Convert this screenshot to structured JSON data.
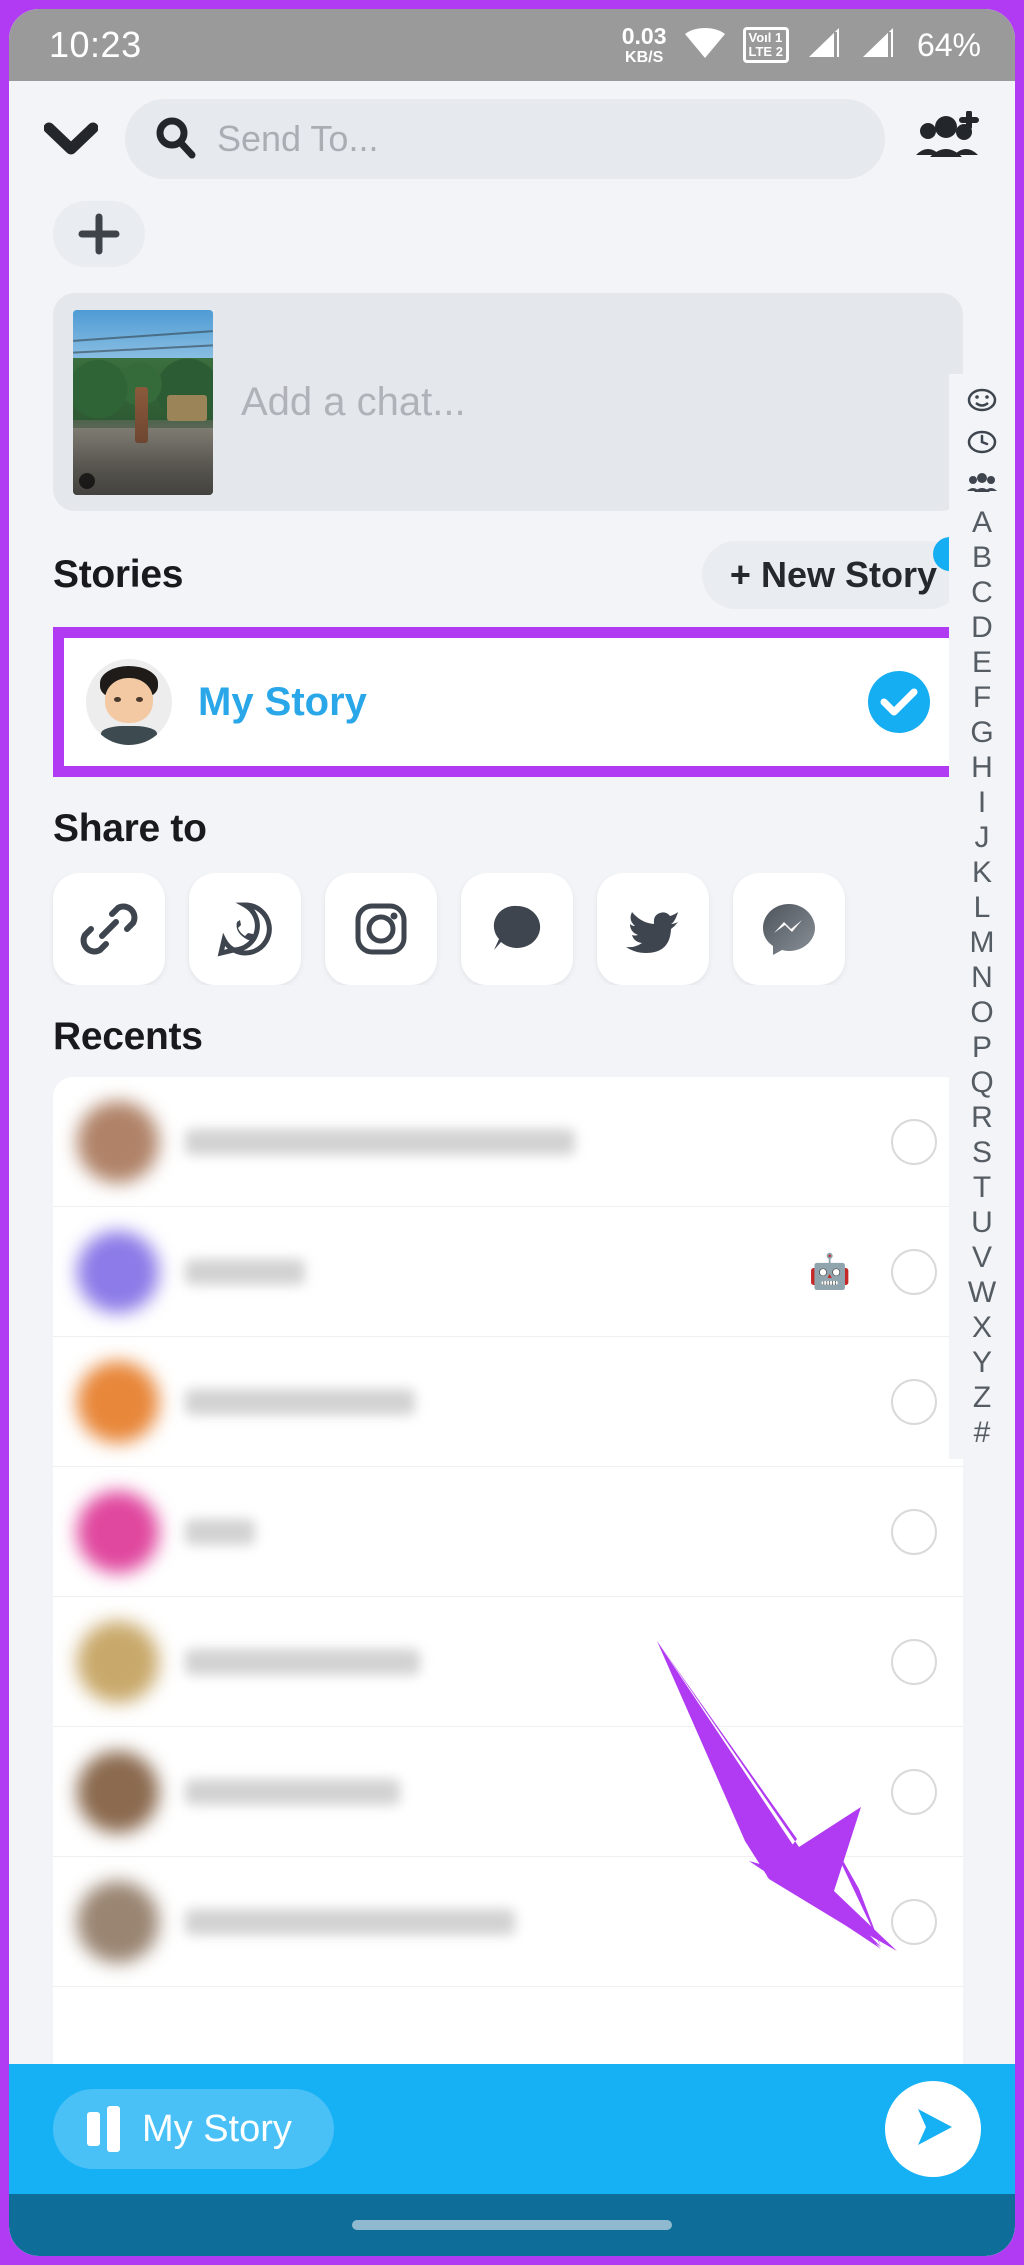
{
  "theme": {
    "accent_purple": "#B13BF2",
    "snap_blue": "#16B0F5",
    "story_link_blue": "#2AA7E8",
    "page_bg": "#F2F4F7",
    "navbar": "#0E6E99"
  },
  "statusbar": {
    "time": "10:23",
    "net_speed_value": "0.03",
    "net_speed_unit": "KB/S",
    "wifi_icon": "wifi-icon",
    "volte_line1": "Voıl 1",
    "volte_line2": "LTE 2",
    "signal1_icon": "signal-bars-icon",
    "signal2_icon": "signal-bars-icon",
    "battery": "64%"
  },
  "header": {
    "collapse_icon": "chevron-down-icon",
    "search_placeholder": "Send To...",
    "search_value": "",
    "search_icon": "search-icon",
    "add_group_icon": "add-group-icon",
    "add_button_label": "+"
  },
  "chat_composer": {
    "thumbnail_alt": "snap-preview-thumbnail",
    "placeholder": "Add a chat..."
  },
  "stories": {
    "title": "Stories",
    "new_story_label": "+ New Story",
    "new_story_has_badge": true,
    "my_story": {
      "label": "My Story",
      "avatar": "bitmoji-avatar",
      "selected": true,
      "check_icon": "check-circle-icon"
    }
  },
  "share_to": {
    "title": "Share to",
    "items": [
      {
        "name": "copy-link-icon",
        "label": "Copy Link"
      },
      {
        "name": "whatsapp-icon",
        "label": "WhatsApp"
      },
      {
        "name": "instagram-icon",
        "label": "Instagram"
      },
      {
        "name": "message-bubble-icon",
        "label": "Messages"
      },
      {
        "name": "twitter-icon",
        "label": "Twitter"
      },
      {
        "name": "messenger-icon",
        "label": "Messenger"
      }
    ]
  },
  "recents": {
    "title": "Recents",
    "rows": [
      {
        "avatar_color": "#B08368",
        "name_width": 390,
        "sub_width": 0,
        "emoji": "",
        "selected": false
      },
      {
        "avatar_color": "#8C7BE8",
        "name_width": 120,
        "sub_width": 0,
        "emoji": "🤖",
        "selected": false
      },
      {
        "avatar_color": "#E8873A",
        "name_width": 230,
        "sub_width": 0,
        "emoji": "",
        "selected": false
      },
      {
        "avatar_color": "#E0479E",
        "name_width": 70,
        "sub_width": 0,
        "emoji": "",
        "selected": false
      },
      {
        "avatar_color": "#C9A96B",
        "name_width": 235,
        "sub_width": 0,
        "emoji": "",
        "selected": false
      },
      {
        "avatar_color": "#8B6A4F",
        "name_width": 215,
        "sub_width": 0,
        "emoji": "",
        "selected": false
      },
      {
        "avatar_color": "#9A8572",
        "name_width": 330,
        "sub_width": 0,
        "emoji": "",
        "selected": false
      }
    ]
  },
  "alphabet_index": {
    "icons": [
      "smiley-icon",
      "clock-icon",
      "group-icon"
    ],
    "letters": [
      "A",
      "B",
      "C",
      "D",
      "E",
      "F",
      "G",
      "H",
      "I",
      "J",
      "K",
      "L",
      "M",
      "N",
      "O",
      "P",
      "Q",
      "R",
      "S",
      "T",
      "U",
      "V",
      "W",
      "X",
      "Y",
      "Z",
      "#"
    ]
  },
  "bottom_bar": {
    "story_chip_label": "My Story",
    "story_chip_icon": "story-cards-icon",
    "send_icon": "send-arrow-icon"
  },
  "annotation": {
    "arrow_color": "#B13BF2",
    "points_to": "send-button"
  },
  "nav_bar": {
    "home_indicator": "home-indicator"
  }
}
